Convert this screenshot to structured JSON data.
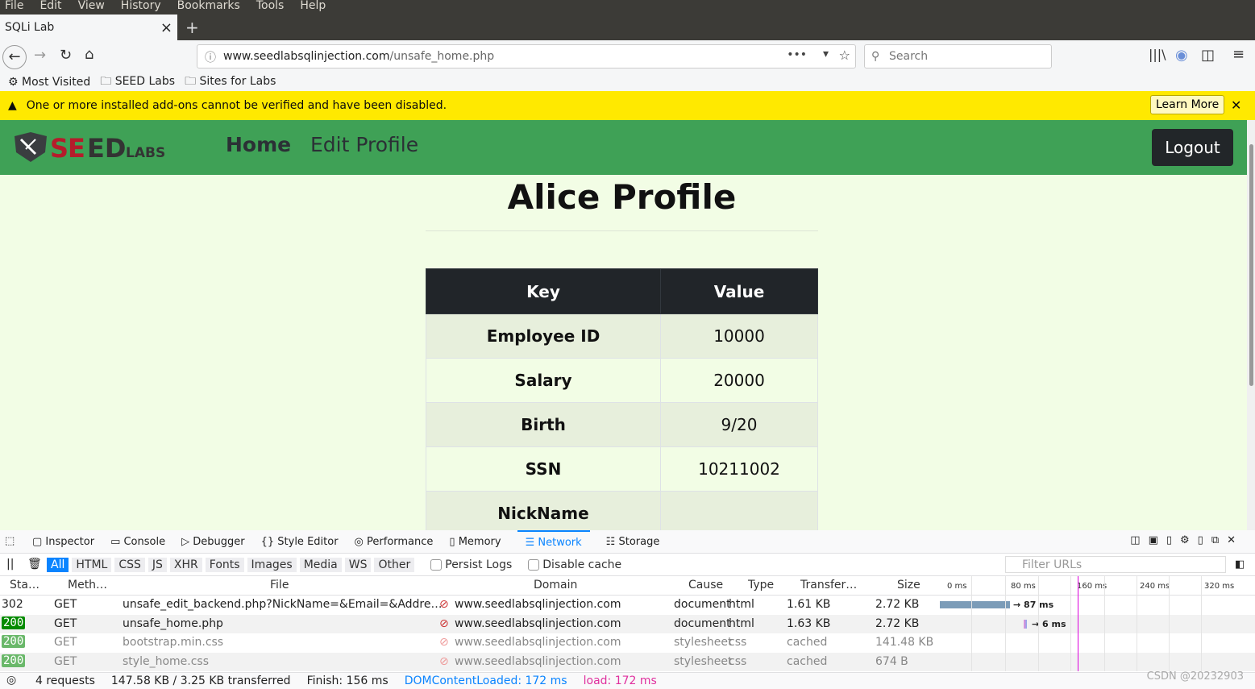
{
  "menubar": [
    "File",
    "Edit",
    "View",
    "History",
    "Bookmarks",
    "Tools",
    "Help"
  ],
  "tab": {
    "title": "SQLi Lab",
    "close": "×",
    "new": "+"
  },
  "url": {
    "domain": "www.seedlabsqlinjection.com",
    "path": "/unsafe_home.php"
  },
  "search_placeholder": "Search",
  "bookmarks": [
    "Most Visited",
    "SEED Labs",
    "Sites for Labs"
  ],
  "warning": {
    "text": "One or more installed add-ons cannot be verified and have been disabled.",
    "button": "Learn More"
  },
  "site": {
    "logo": "SEEDLABS",
    "nav": [
      "Home",
      "Edit Profile"
    ],
    "logout": "Logout"
  },
  "profile": {
    "title": "Alice Profile",
    "headers": [
      "Key",
      "Value"
    ],
    "rows": [
      [
        "Employee ID",
        "10000"
      ],
      [
        "Salary",
        "20000"
      ],
      [
        "Birth",
        "9/20"
      ],
      [
        "SSN",
        "10211002"
      ],
      [
        "NickName",
        ""
      ]
    ]
  },
  "devtools": {
    "tabs": [
      "Inspector",
      "Console",
      "Debugger",
      "Style Editor",
      "Performance",
      "Memory",
      "Network",
      "Storage"
    ],
    "active_tab": "Network",
    "filters": [
      "All",
      "HTML",
      "CSS",
      "JS",
      "XHR",
      "Fonts",
      "Images",
      "Media",
      "WS",
      "Other"
    ],
    "persist": "Persist Logs",
    "disable_cache": "Disable cache",
    "filter_placeholder": "Filter URLs",
    "columns": [
      "Sta…",
      "Meth…",
      "File",
      "Domain",
      "Cause",
      "Type",
      "Transfer…",
      "Size"
    ],
    "timeline_ticks": [
      "0 ms",
      "80 ms",
      "160 ms",
      "240 ms",
      "320 ms"
    ],
    "requests": [
      {
        "status": "302",
        "method": "GET",
        "file": "unsafe_edit_backend.php?NickName=&Email=&Addre…",
        "domain": "www.seedlabsqlinjection.com",
        "cause": "document",
        "type": "html",
        "transferred": "1.61 KB",
        "size": "2.72 KB",
        "timing": "→ 87 ms"
      },
      {
        "status": "200",
        "method": "GET",
        "file": "unsafe_home.php",
        "domain": "www.seedlabsqlinjection.com",
        "cause": "document",
        "type": "html",
        "transferred": "1.63 KB",
        "size": "2.72 KB",
        "timing": "→ 6 ms"
      },
      {
        "status": "200",
        "method": "GET",
        "file": "bootstrap.min.css",
        "domain": "www.seedlabsqlinjection.com",
        "cause": "stylesheet",
        "type": "css",
        "transferred": "cached",
        "size": "141.48 KB",
        "timing": ""
      },
      {
        "status": "200",
        "method": "GET",
        "file": "style_home.css",
        "domain": "www.seedlabsqlinjection.com",
        "cause": "stylesheet",
        "type": "css",
        "transferred": "cached",
        "size": "674 B",
        "timing": ""
      }
    ],
    "summary": {
      "requests": "4 requests",
      "transferred": "147.58 KB / 3.25 KB transferred",
      "finish": "Finish: 156 ms",
      "dcl": "DOMContentLoaded: 172 ms",
      "load": "load: 172 ms"
    }
  },
  "watermark": "CSDN @20232903"
}
